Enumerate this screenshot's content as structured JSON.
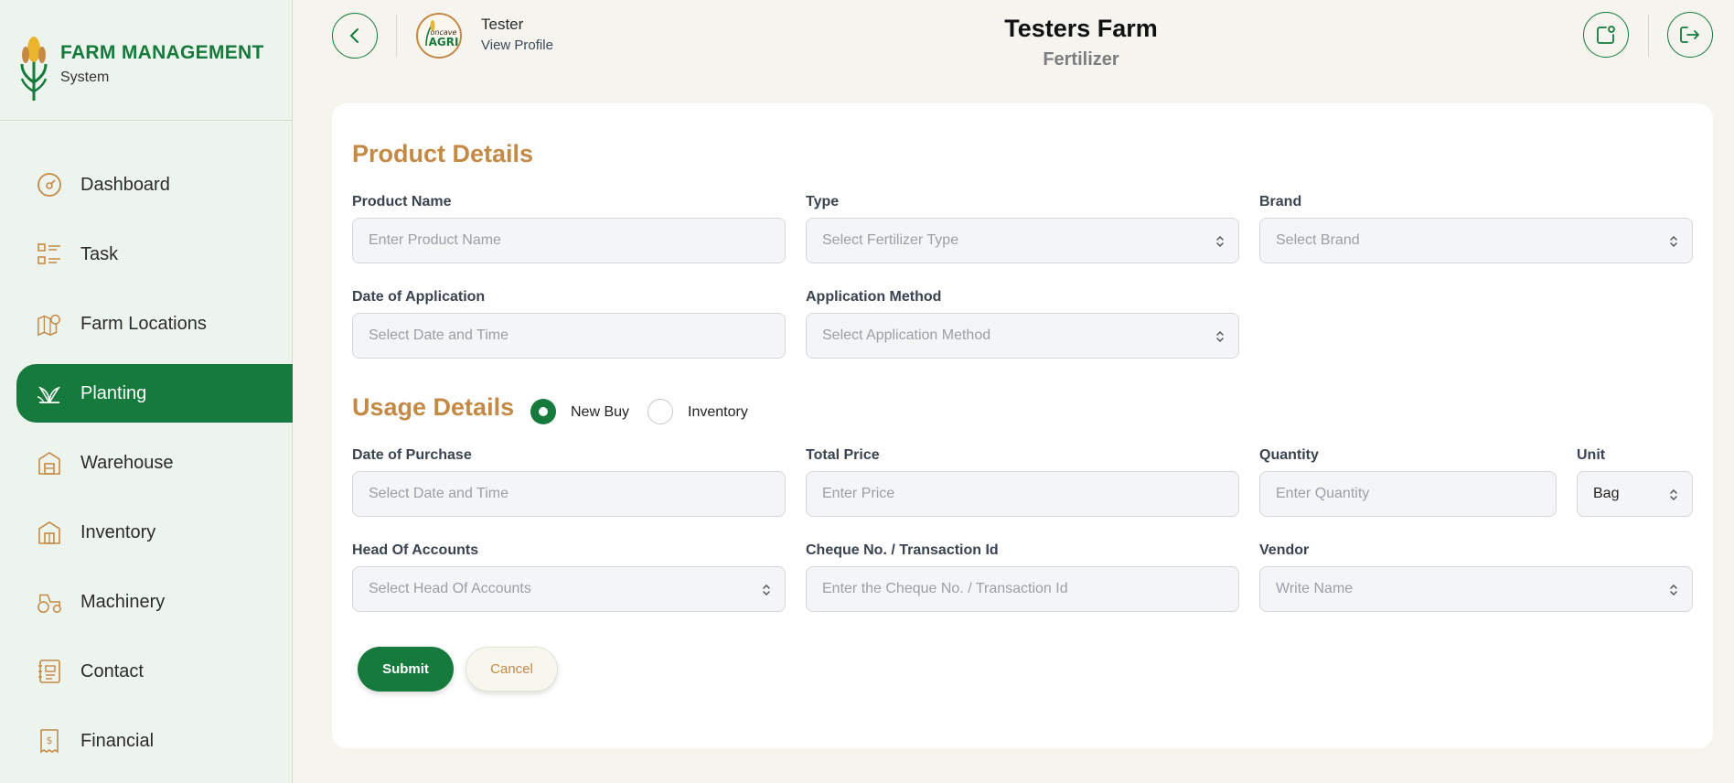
{
  "brand": {
    "title": "FARM MANAGEMENT",
    "subtitle": "System"
  },
  "sidebar": {
    "items": [
      {
        "label": "Dashboard",
        "icon": "dashboard-icon",
        "active": false
      },
      {
        "label": "Task",
        "icon": "task-list-icon",
        "active": false
      },
      {
        "label": "Farm Locations",
        "icon": "map-icon",
        "active": false
      },
      {
        "label": "Planting",
        "icon": "plant-icon",
        "active": true
      },
      {
        "label": "Warehouse",
        "icon": "warehouse-icon",
        "active": false
      },
      {
        "label": "Inventory",
        "icon": "inventory-icon",
        "active": false
      },
      {
        "label": "Machinery",
        "icon": "tractor-icon",
        "active": false
      },
      {
        "label": "Contact",
        "icon": "contact-book-icon",
        "active": false
      },
      {
        "label": "Financial",
        "icon": "receipt-icon",
        "active": false
      }
    ]
  },
  "header": {
    "user_name": "Tester",
    "profile_link": "View Profile",
    "avatar_text": "Concave AGRI",
    "farm_name": "Testers Farm",
    "page": "Fertilizer"
  },
  "product": {
    "title": "Product Details",
    "product_name": {
      "label": "Product Name",
      "placeholder": "Enter Product Name"
    },
    "type": {
      "label": "Type",
      "placeholder": "Select Fertilizer Type"
    },
    "brand": {
      "label": "Brand",
      "placeholder": "Select Brand"
    },
    "date_of_application": {
      "label": "Date of Application",
      "placeholder": "Select Date and Time"
    },
    "application_method": {
      "label": "Application Method",
      "placeholder": "Select Application Method"
    }
  },
  "usage": {
    "title": "Usage Details",
    "radio_new_buy": "New Buy",
    "radio_inventory": "Inventory",
    "selected": "New Buy",
    "date_of_purchase": {
      "label": "Date of Purchase",
      "placeholder": "Select Date and Time"
    },
    "total_price": {
      "label": "Total Price",
      "placeholder": "Enter Price"
    },
    "quantity": {
      "label": "Quantity",
      "placeholder": "Enter Quantity"
    },
    "unit": {
      "label": "Unit",
      "value": "Bag"
    },
    "head_of_accounts": {
      "label": "Head Of Accounts",
      "placeholder": "Select Head Of Accounts"
    },
    "cheque": {
      "label": "Cheque No. / Transaction Id",
      "placeholder": "Enter the Cheque No. / Transaction Id"
    },
    "vendor": {
      "label": "Vendor",
      "placeholder": "Write Name"
    }
  },
  "actions": {
    "submit": "Submit",
    "cancel": "Cancel"
  },
  "colors": {
    "primary": "#157a3b",
    "accent": "#c48a45",
    "page_bg": "#f5f4ee",
    "sidebar_bg": "#edf4ee"
  }
}
